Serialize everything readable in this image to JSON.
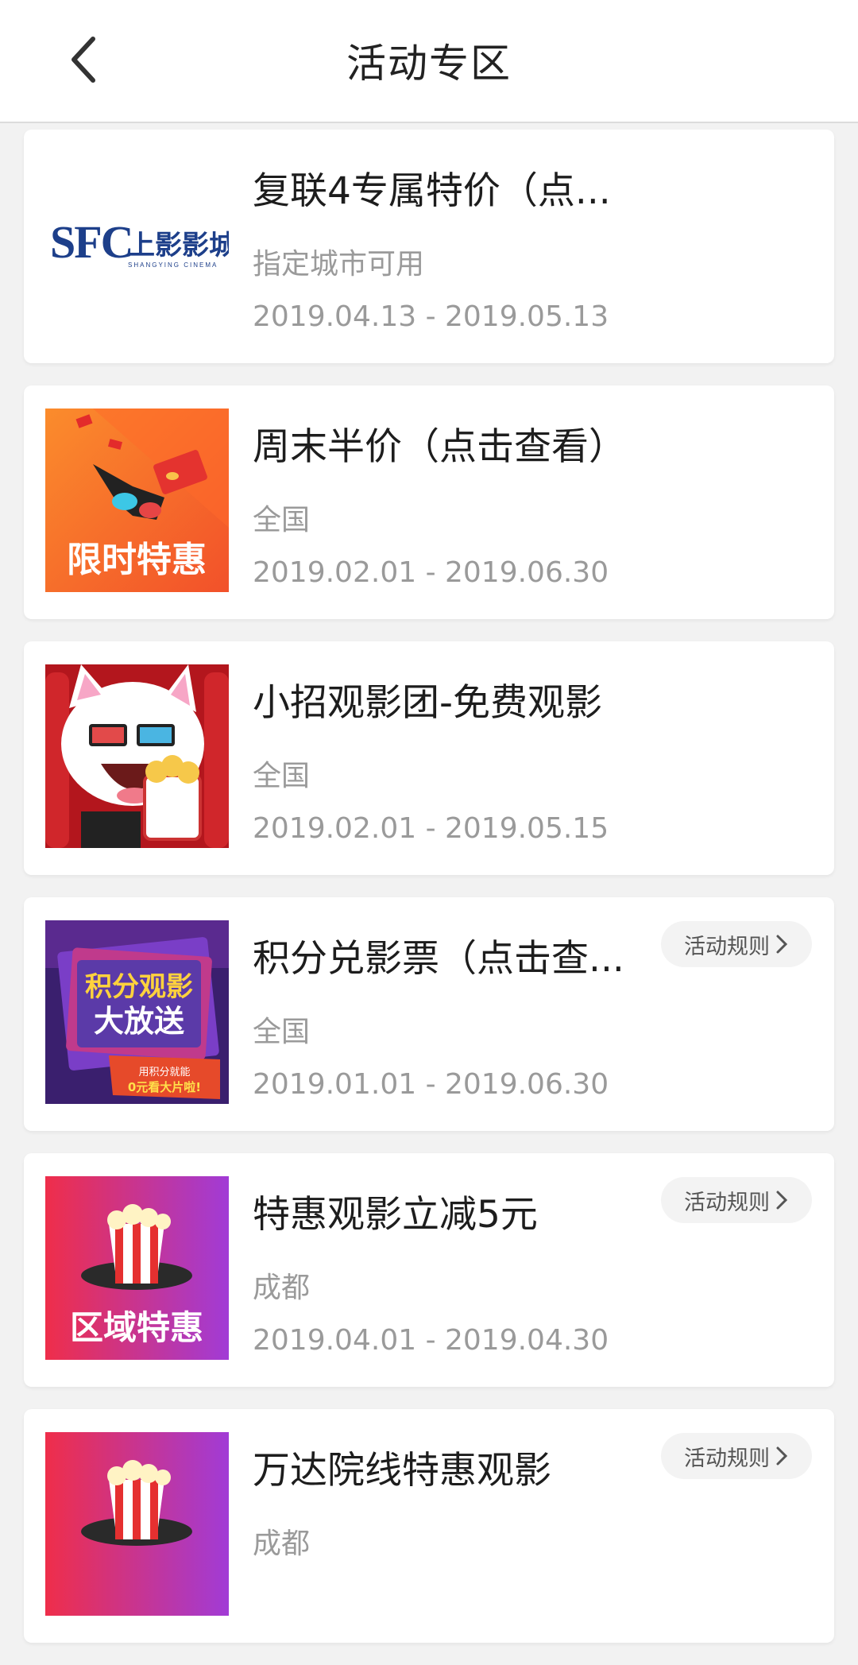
{
  "header": {
    "title": "活动专区",
    "back_icon": "chevron-left-icon"
  },
  "activities": [
    {
      "title": "复联4专属特价（点...",
      "region": "指定城市可用",
      "date_range": "2019.04.13 - 2019.05.13",
      "thumb": "sfc-logo",
      "thumb_text": "SFC 上影影城",
      "has_rule": false
    },
    {
      "title": "周末半价（点击查看）",
      "region": "全国",
      "date_range": "2019.02.01 - 2019.06.30",
      "thumb": "limited-time-promo",
      "thumb_text": "限时特惠",
      "has_rule": false
    },
    {
      "title": "小招观影团-免费观影",
      "region": "全国",
      "date_range": "2019.02.01 - 2019.05.15",
      "thumb": "cat-mascot",
      "has_rule": false
    },
    {
      "title": "积分兑影票（点击查...",
      "region": "全国",
      "date_range": "2019.01.01 - 2019.06.30",
      "thumb": "points-promo",
      "thumb_text": "积分观影大放送",
      "thumb_subtext": "用积分就能0元看大片啦!",
      "has_rule": true,
      "rule_label": "活动规则"
    },
    {
      "title": "特惠观影立减5元",
      "region": "成都",
      "date_range": "2019.04.01 - 2019.04.30",
      "thumb": "regional-promo",
      "thumb_text": "区域特惠",
      "has_rule": true,
      "rule_label": "活动规则"
    },
    {
      "title": "万达院线特惠观影",
      "region": "成都",
      "date_range": "",
      "thumb": "popcorn-promo",
      "has_rule": true,
      "rule_label": "活动规则"
    }
  ],
  "colors": {
    "background": "#f2f2f2",
    "card": "#ffffff",
    "title_text": "#1d1d1d",
    "meta_text": "#9a9a9a",
    "promo_orange": "#f7772a",
    "promo_red": "#e93a3a",
    "promo_purple": "#a53bd3"
  }
}
